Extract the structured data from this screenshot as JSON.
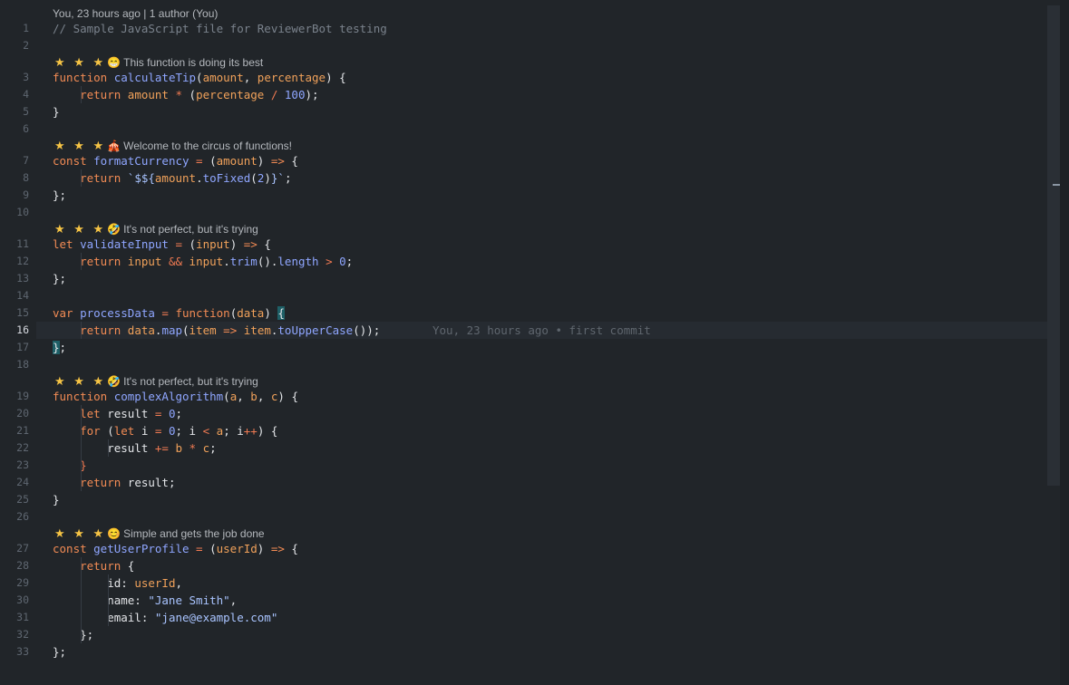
{
  "blame_header": "You, 23 hours ago | 1 author (You)",
  "inline_blame": "You, 23 hours ago • first commit",
  "active_line": 16,
  "colors": {
    "background": "#212529",
    "keyword": "#f28b54",
    "function": "#8fa6ff",
    "parameter": "#f0a15a",
    "stars": "#f6c445"
  },
  "lenses": [
    {
      "stars": "★ ★ ★",
      "icon": "grin-emoji-icon",
      "glyph": "😁",
      "text": "This function is doing its best"
    },
    {
      "stars": "★ ★ ★",
      "icon": "circus-tent-emoji-icon",
      "glyph": "🎪",
      "text": "Welcome to the circus of functions!"
    },
    {
      "stars": "★ ★ ★",
      "icon": "rofl-emoji-icon",
      "glyph": "🤣",
      "text": "It's not perfect, but it's trying"
    },
    {
      "stars": "★ ★ ★",
      "icon": "rofl-emoji-icon",
      "glyph": "🤣",
      "text": "It's not perfect, but it's trying"
    },
    {
      "stars": "★ ★ ★",
      "icon": "smile-emoji-icon",
      "glyph": "😊",
      "text": "Simple and gets the job done"
    }
  ],
  "line_numbers": [
    "1",
    "2",
    "3",
    "4",
    "5",
    "6",
    "7",
    "8",
    "9",
    "10",
    "11",
    "12",
    "13",
    "14",
    "15",
    "16",
    "17",
    "18",
    "19",
    "20",
    "21",
    "22",
    "23",
    "24",
    "25",
    "26",
    "27",
    "28",
    "29",
    "30",
    "31",
    "32",
    "33"
  ],
  "lines": [
    [
      [
        "cm",
        "// Sample JavaScript file for ReviewerBot testing"
      ]
    ],
    [],
    [
      [
        "kw",
        "function "
      ],
      [
        "fn",
        "calculateTip"
      ],
      [
        "pn",
        "("
      ],
      [
        "pr",
        "amount"
      ],
      [
        "pn",
        ", "
      ],
      [
        "pr",
        "percentage"
      ],
      [
        "pn",
        ") {"
      ]
    ],
    [
      [
        "pn",
        "    "
      ],
      [
        "kw",
        "return "
      ],
      [
        "pr",
        "amount"
      ],
      [
        "op",
        " * "
      ],
      [
        "pn",
        "("
      ],
      [
        "pr",
        "percentage"
      ],
      [
        "op",
        " / "
      ],
      [
        "num",
        "100"
      ],
      [
        "pn",
        ");"
      ]
    ],
    [
      [
        "pn",
        "}"
      ]
    ],
    [],
    [
      [
        "kw",
        "const "
      ],
      [
        "fn",
        "formatCurrency"
      ],
      [
        "op",
        " = "
      ],
      [
        "pn",
        "("
      ],
      [
        "pr",
        "amount"
      ],
      [
        "pn",
        ") "
      ],
      [
        "kw",
        "=>"
      ],
      [
        "pn",
        " {"
      ]
    ],
    [
      [
        "pn",
        "    "
      ],
      [
        "kw",
        "return "
      ],
      [
        "str",
        "`$${"
      ],
      [
        "pr",
        "amount"
      ],
      [
        "pn",
        "."
      ],
      [
        "fn",
        "toFixed"
      ],
      [
        "pn",
        "("
      ],
      [
        "num",
        "2"
      ],
      [
        "pn",
        ")"
      ],
      [
        "str",
        "}`"
      ],
      [
        "pn",
        ";"
      ]
    ],
    [
      [
        "pn",
        "};"
      ]
    ],
    [],
    [
      [
        "kw",
        "let "
      ],
      [
        "fn",
        "validateInput"
      ],
      [
        "op",
        " = "
      ],
      [
        "pn",
        "("
      ],
      [
        "pr",
        "input"
      ],
      [
        "pn",
        ") "
      ],
      [
        "kw",
        "=>"
      ],
      [
        "pn",
        " {"
      ]
    ],
    [
      [
        "pn",
        "    "
      ],
      [
        "kw",
        "return "
      ],
      [
        "pr",
        "input"
      ],
      [
        "op",
        " && "
      ],
      [
        "pr",
        "input"
      ],
      [
        "pn",
        "."
      ],
      [
        "fn",
        "trim"
      ],
      [
        "pn",
        "()."
      ],
      [
        "fn",
        "length"
      ],
      [
        "op",
        " > "
      ],
      [
        "num",
        "0"
      ],
      [
        "pn",
        ";"
      ]
    ],
    [
      [
        "pn",
        "};"
      ]
    ],
    [],
    [
      [
        "kw",
        "var "
      ],
      [
        "fn",
        "processData"
      ],
      [
        "op",
        " = "
      ],
      [
        "kw",
        "function"
      ],
      [
        "pn",
        "("
      ],
      [
        "pr",
        "data"
      ],
      [
        "pn",
        ") "
      ],
      [
        "hl",
        "{"
      ]
    ],
    [
      [
        "pn",
        "    "
      ],
      [
        "kw",
        "return "
      ],
      [
        "pr",
        "data"
      ],
      [
        "pn",
        "."
      ],
      [
        "fn",
        "map"
      ],
      [
        "pn",
        "("
      ],
      [
        "pr",
        "item"
      ],
      [
        "kw",
        " => "
      ],
      [
        "pr",
        "item"
      ],
      [
        "pn",
        "."
      ],
      [
        "fn",
        "toUpperCase"
      ],
      [
        "pn",
        "());"
      ]
    ],
    [
      [
        "hl",
        "}"
      ],
      [
        "pn",
        ";"
      ]
    ],
    [],
    [
      [
        "kw",
        "function "
      ],
      [
        "fn",
        "complexAlgorithm"
      ],
      [
        "pn",
        "("
      ],
      [
        "pr",
        "a"
      ],
      [
        "pn",
        ", "
      ],
      [
        "pr",
        "b"
      ],
      [
        "pn",
        ", "
      ],
      [
        "pr",
        "c"
      ],
      [
        "pn",
        ") {"
      ]
    ],
    [
      [
        "pn",
        "    "
      ],
      [
        "kw",
        "let "
      ],
      [
        "pn",
        "result"
      ],
      [
        "op",
        " = "
      ],
      [
        "num",
        "0"
      ],
      [
        "pn",
        ";"
      ]
    ],
    [
      [
        "pn",
        "    "
      ],
      [
        "kw",
        "for "
      ],
      [
        "pn",
        "("
      ],
      [
        "kw",
        "let "
      ],
      [
        "pn",
        "i"
      ],
      [
        "op",
        " = "
      ],
      [
        "num",
        "0"
      ],
      [
        "pn",
        "; i"
      ],
      [
        "op",
        " < "
      ],
      [
        "pr",
        "a"
      ],
      [
        "pn",
        "; i"
      ],
      [
        "op",
        "++"
      ],
      [
        "pn",
        ") {"
      ]
    ],
    [
      [
        "pn",
        "        result"
      ],
      [
        "op",
        " += "
      ],
      [
        "pr",
        "b"
      ],
      [
        "op",
        " * "
      ],
      [
        "pr",
        "c"
      ],
      [
        "pn",
        ";"
      ]
    ],
    [
      [
        "op",
        "    }"
      ]
    ],
    [
      [
        "pn",
        "    "
      ],
      [
        "kw",
        "return "
      ],
      [
        "pn",
        "result;"
      ]
    ],
    [
      [
        "pn",
        "}"
      ]
    ],
    [],
    [
      [
        "kw",
        "const "
      ],
      [
        "fn",
        "getUserProfile"
      ],
      [
        "op",
        " = "
      ],
      [
        "pn",
        "("
      ],
      [
        "pr",
        "userId"
      ],
      [
        "pn",
        ") "
      ],
      [
        "kw",
        "=>"
      ],
      [
        "pn",
        " {"
      ]
    ],
    [
      [
        "pn",
        "    "
      ],
      [
        "kw",
        "return "
      ],
      [
        "pn",
        "{"
      ]
    ],
    [
      [
        "pn",
        "        id: "
      ],
      [
        "pr",
        "userId"
      ],
      [
        "pn",
        ","
      ]
    ],
    [
      [
        "pn",
        "        name: "
      ],
      [
        "str",
        "\"Jane Smith\""
      ],
      [
        "pn",
        ","
      ]
    ],
    [
      [
        "pn",
        "        email: "
      ],
      [
        "str",
        "\"jane@example.com\""
      ]
    ],
    [
      [
        "pn",
        "    };"
      ]
    ],
    [
      [
        "pn",
        "};"
      ]
    ]
  ]
}
